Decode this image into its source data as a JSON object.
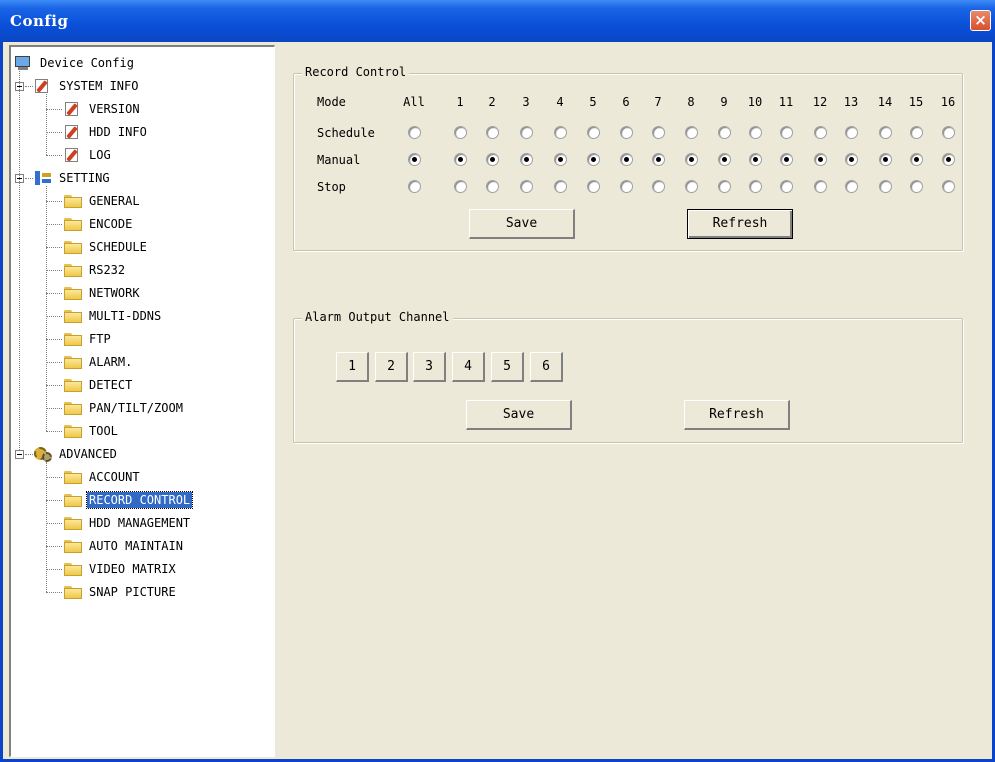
{
  "window": {
    "title": "Config",
    "close_glyph": "×"
  },
  "tree": {
    "root": {
      "label": "Device Config",
      "icon": "monitor-icon"
    },
    "system_info": {
      "label": "SYSTEM INFO",
      "icon": "doc-edit-icon",
      "children": [
        "VERSION",
        "HDD INFO",
        "LOG"
      ]
    },
    "setting": {
      "label": "SETTING",
      "icon": "tool-icon",
      "children": [
        "GENERAL",
        "ENCODE",
        "SCHEDULE",
        "RS232",
        "NETWORK",
        "MULTI-DDNS",
        "FTP",
        "ALARM.",
        "DETECT",
        "PAN/TILT/ZOOM",
        "TOOL"
      ]
    },
    "advanced": {
      "label": "ADVANCED",
      "icon": "gear-icon",
      "children": [
        "ACCOUNT",
        "RECORD CONTROL",
        "HDD MANAGEMENT",
        "AUTO MAINTAIN",
        "VIDEO MATRIX",
        "SNAP PICTURE"
      ],
      "selected": "RECORD CONTROL"
    }
  },
  "record_control": {
    "title": "Record Control",
    "mode_label": "Mode",
    "all_label": "All",
    "channels": [
      "1",
      "2",
      "3",
      "4",
      "5",
      "6",
      "7",
      "8",
      "9",
      "10",
      "11",
      "12",
      "13",
      "14",
      "15",
      "16"
    ],
    "rows": [
      {
        "label": "Schedule",
        "checked": false
      },
      {
        "label": "Manual",
        "checked": true
      },
      {
        "label": "Stop",
        "checked": false
      }
    ],
    "save_label": "Save",
    "refresh_label": "Refresh"
  },
  "alarm_output": {
    "title": "Alarm Output Channel",
    "channels": [
      "1",
      "2",
      "3",
      "4",
      "5",
      "6"
    ],
    "save_label": "Save",
    "refresh_label": "Refresh"
  }
}
